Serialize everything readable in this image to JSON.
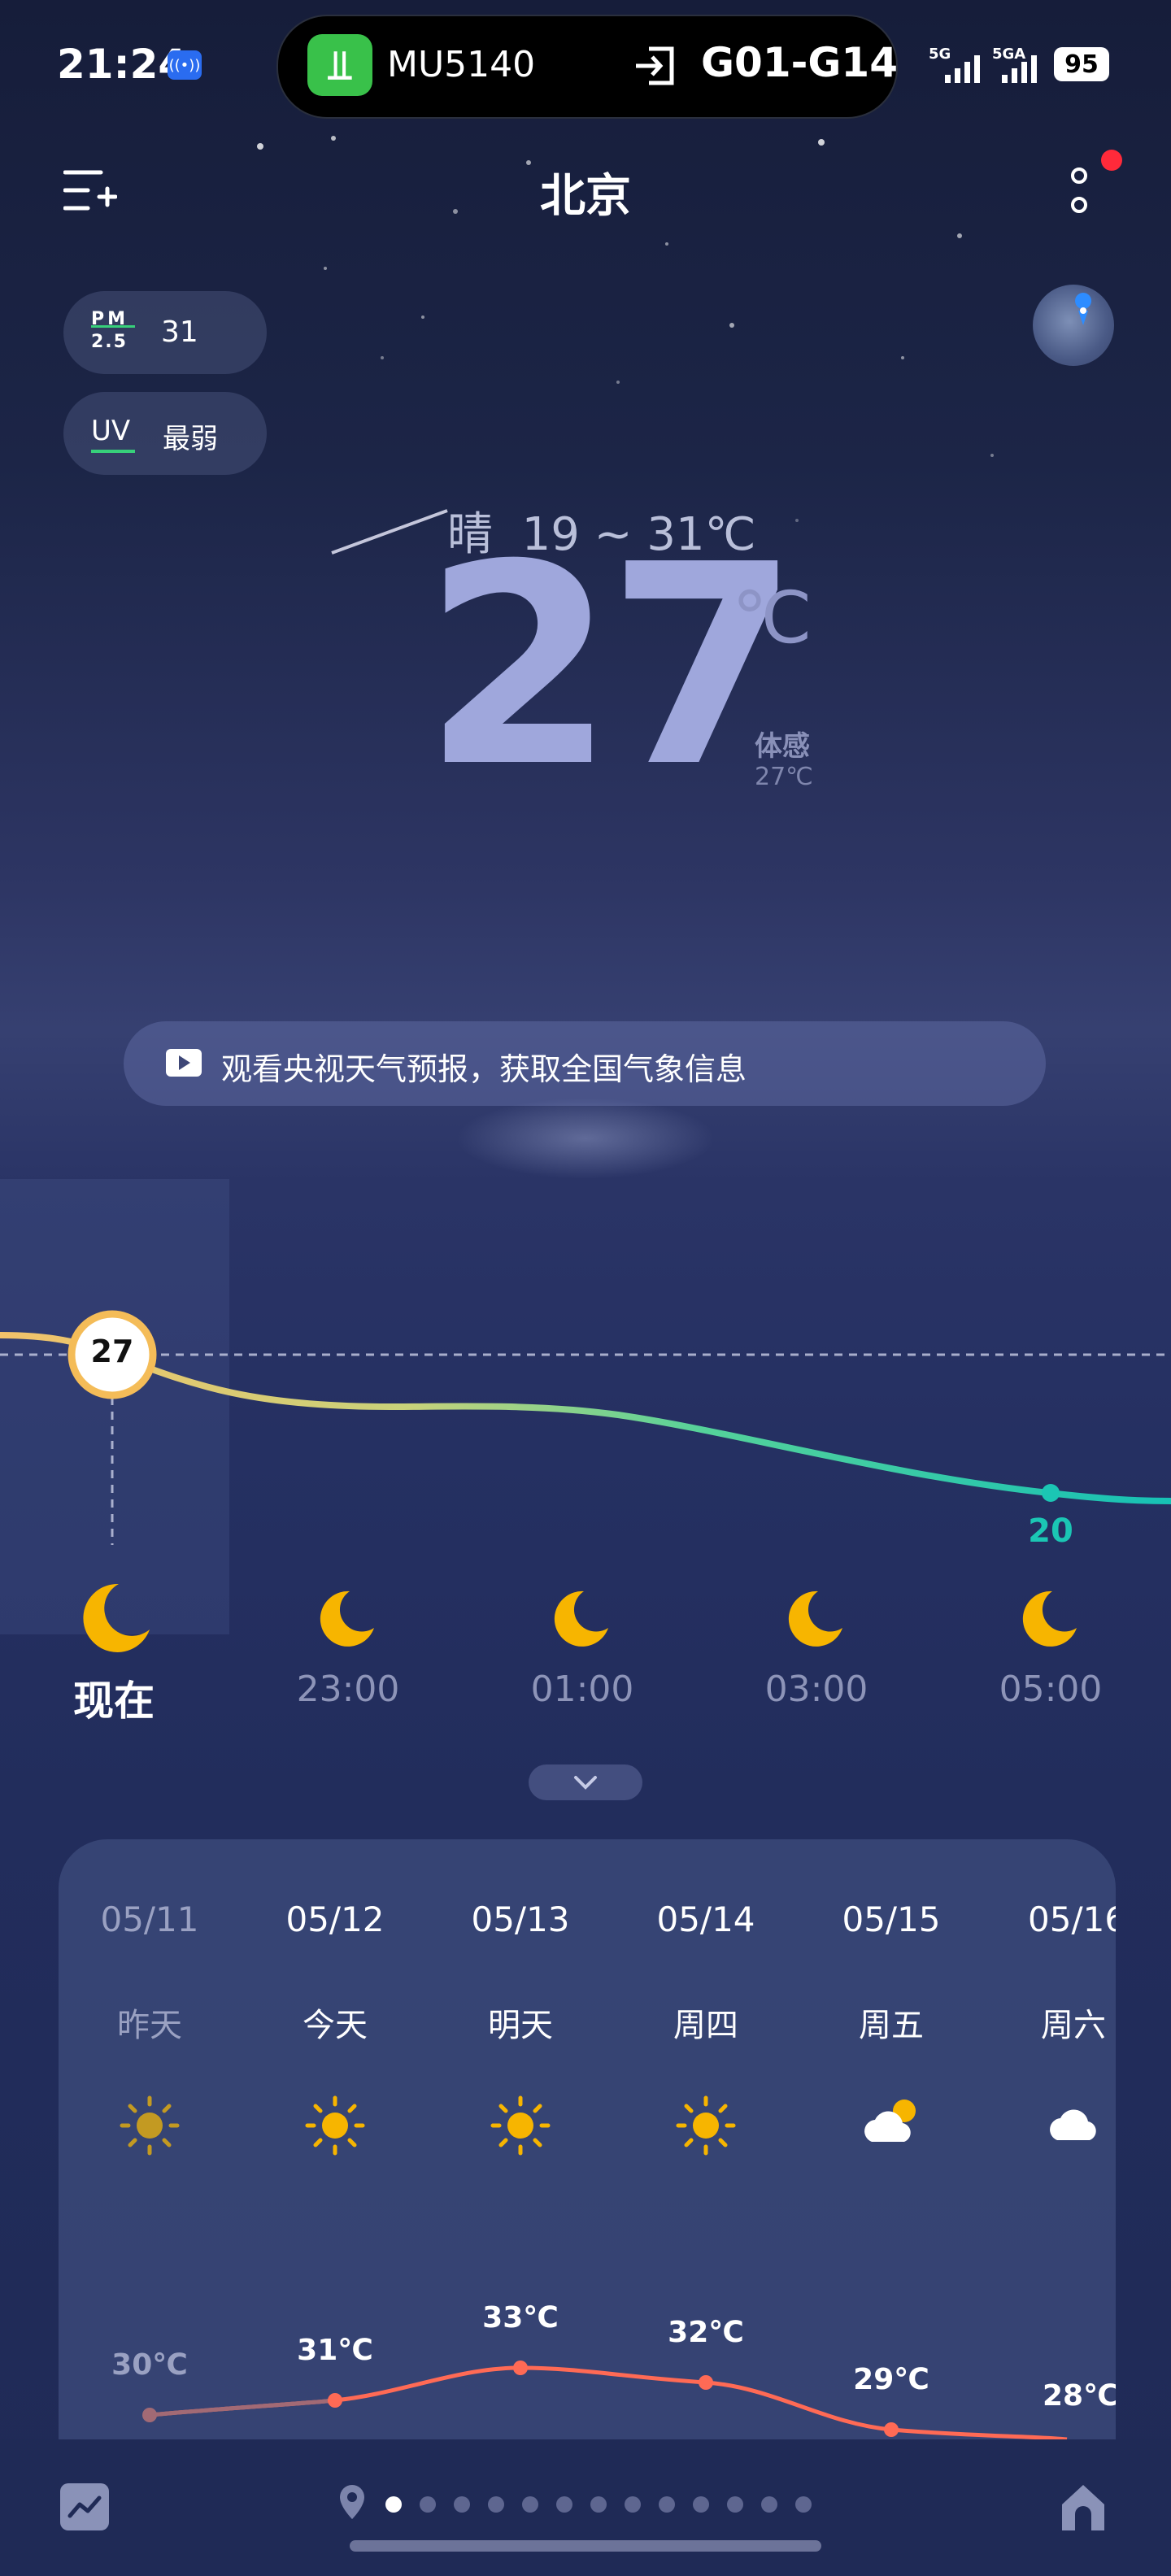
{
  "status_bar": {
    "time": "21:24",
    "flight_number": "MU5140",
    "gate": "G01-G14",
    "signal_1": "5G",
    "signal_2": "5GA",
    "battery": "95"
  },
  "header": {
    "city": "北京",
    "add_city_icon": "list-add-icon",
    "menu_icon": "more-vertical-icon"
  },
  "air": {
    "pm_label_top": "PM",
    "pm_label_bottom": "2.5",
    "pm_value": "31",
    "uv_label": "UV",
    "uv_value": "最弱"
  },
  "current": {
    "condition": "晴",
    "range": "19 ~ 31℃",
    "temperature": "27",
    "unit": "℃",
    "feels_label": "体感",
    "feels_value": "27℃"
  },
  "banner": {
    "text": "观看央视天气预报，获取全国气象信息"
  },
  "hourly": {
    "now_marker": "27",
    "end_marker": "20",
    "items": [
      {
        "label": "现在",
        "icon": "moon-icon"
      },
      {
        "label": "23:00",
        "icon": "moon-icon"
      },
      {
        "label": "01:00",
        "icon": "moon-icon"
      },
      {
        "label": "03:00",
        "icon": "moon-icon"
      },
      {
        "label": "05:00",
        "icon": "moon-icon"
      }
    ]
  },
  "daily": {
    "days": [
      {
        "date": "05/11",
        "name": "昨天",
        "icon": "sun-icon",
        "high": "30℃"
      },
      {
        "date": "05/12",
        "name": "今天",
        "icon": "sun-icon",
        "high": "31℃"
      },
      {
        "date": "05/13",
        "name": "明天",
        "icon": "sun-icon",
        "high": "33℃"
      },
      {
        "date": "05/14",
        "name": "周四",
        "icon": "sun-icon",
        "high": "32℃"
      },
      {
        "date": "05/15",
        "name": "周五",
        "icon": "partly-cloudy-icon",
        "high": "29℃"
      },
      {
        "date": "05/16",
        "name": "周六",
        "icon": "cloud-icon",
        "high": "28℃"
      }
    ]
  },
  "colors": {
    "accent_teal": "#1bc6b4",
    "sun_yellow": "#f7b500",
    "curve_red": "#ff6a55",
    "alert_red": "#ff2a3a"
  }
}
